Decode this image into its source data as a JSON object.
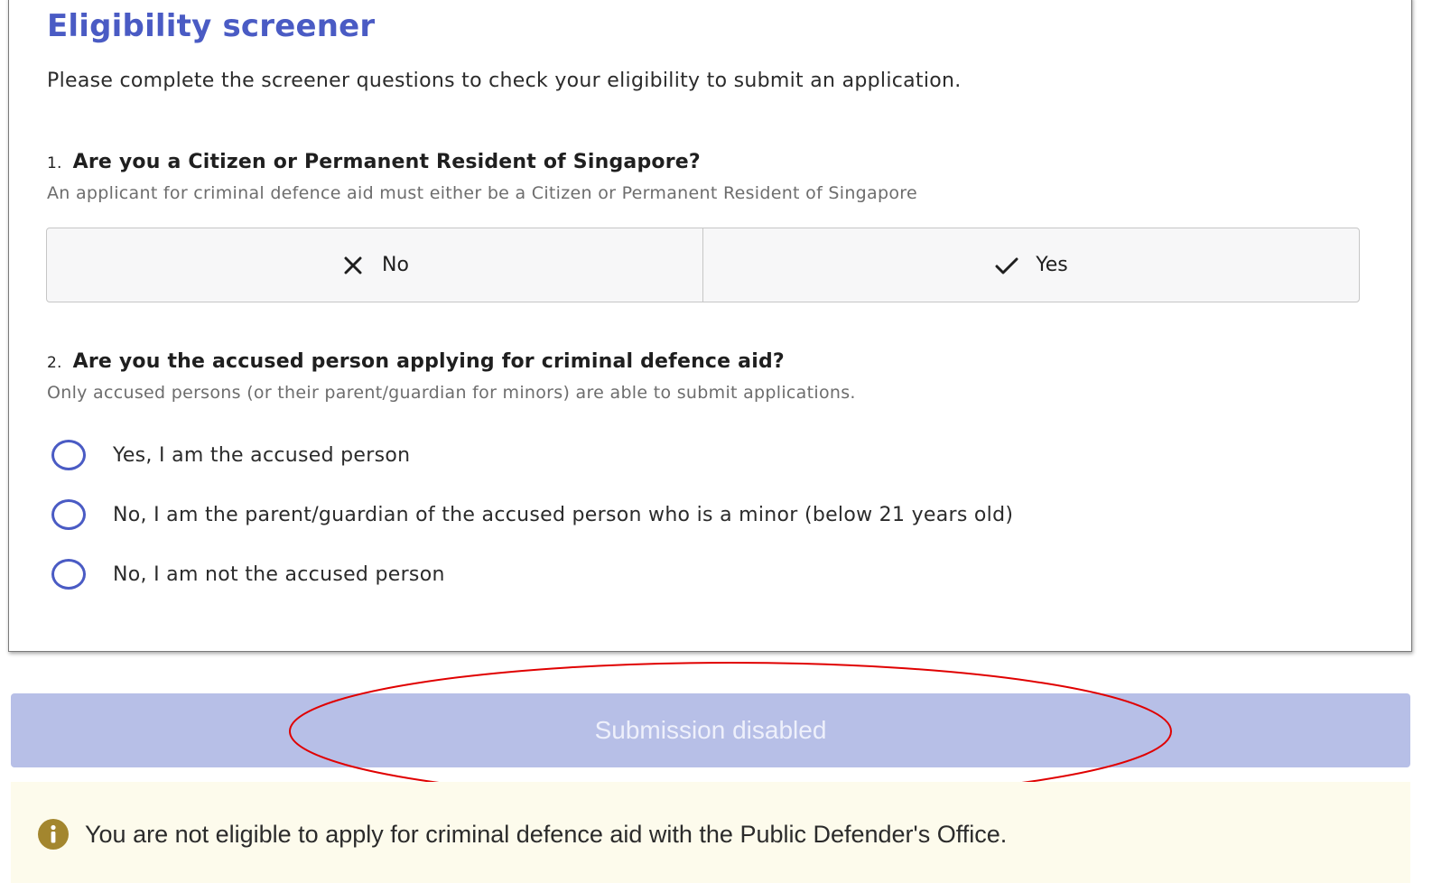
{
  "screener": {
    "title": "Eligibility screener",
    "intro": "Please complete the screener questions to check your eligibility to submit an application."
  },
  "questions": [
    {
      "number": "1.",
      "label": "Are you a Citizen or Permanent Resident of Singapore?",
      "help": "An applicant for criminal defence aid must either be a Citizen or Permanent Resident of Singapore",
      "options": [
        {
          "label": "No",
          "icon": "close-icon"
        },
        {
          "label": "Yes",
          "icon": "check-icon"
        }
      ]
    },
    {
      "number": "2.",
      "label": "Are you the accused person applying for criminal defence aid?",
      "help": "Only accused persons (or their parent/guardian for minors) are able to submit applications.",
      "options": [
        {
          "label": "Yes, I am the accused person"
        },
        {
          "label": "No, I am the parent/guardian of the accused person who is a minor (below 21 years old)"
        },
        {
          "label": "No, I am not the accused person"
        }
      ]
    }
  ],
  "submit": {
    "label": "Submission disabled",
    "enabled": false
  },
  "notice": {
    "icon": "info-icon",
    "text": "You are not eligible to apply for criminal defence aid with the Public Defender's Office."
  },
  "colors": {
    "accent": "#4a5bc4",
    "disabled_button": "#b7bfe7",
    "notice_bg": "#fdfbec",
    "info_icon": "#a3862e",
    "annotation": "#e00000"
  }
}
